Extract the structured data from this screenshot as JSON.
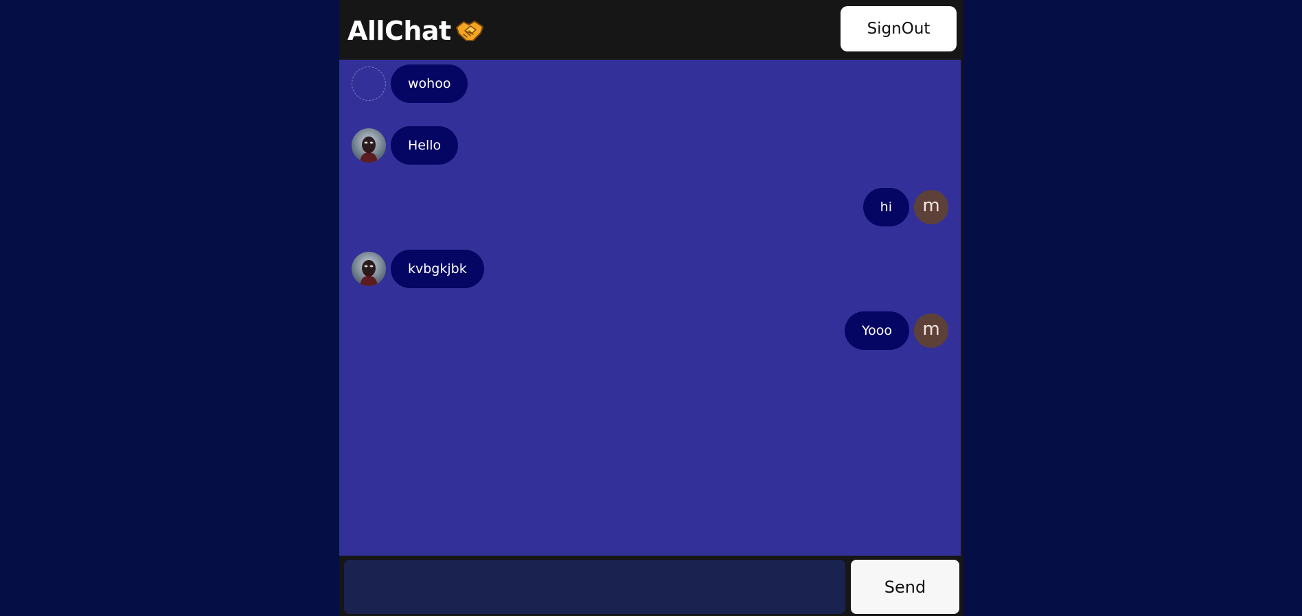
{
  "app": {
    "title": "AllChat",
    "logo_icon": "handshake-icon",
    "colors": {
      "page_background": "#050e45",
      "chat_background": "#333199",
      "bubble": "#050563",
      "header": "#161616",
      "input": "#1a2250",
      "letter_avatar": "#5d4037"
    }
  },
  "header": {
    "signout_label": "SignOut"
  },
  "messages": [
    {
      "text": "wohoo",
      "side": "left",
      "avatar": "empty"
    },
    {
      "text": "Hello",
      "side": "left",
      "avatar": "photo"
    },
    {
      "text": "hi",
      "side": "right",
      "avatar": "letter",
      "avatar_letter": "m"
    },
    {
      "text": "kvbgkjbk",
      "side": "left",
      "avatar": "photo"
    },
    {
      "text": "Yooo",
      "side": "right",
      "avatar": "letter",
      "avatar_letter": "m"
    }
  ],
  "composer": {
    "input_value": "",
    "placeholder": "",
    "send_label": "Send"
  }
}
